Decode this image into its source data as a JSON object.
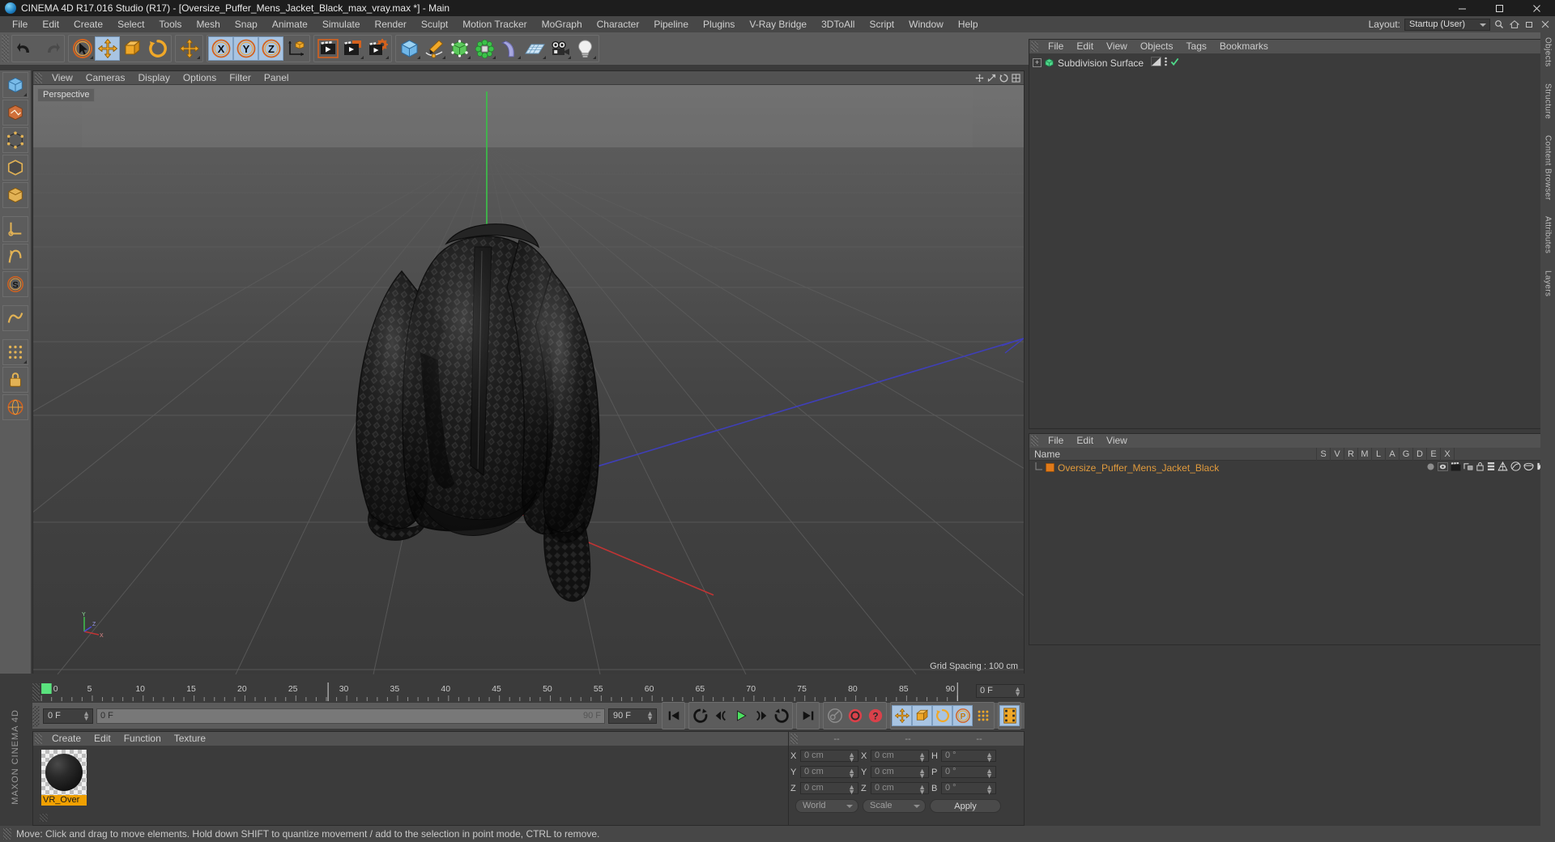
{
  "window": {
    "title": "CINEMA 4D R17.016 Studio (R17) - [Oversize_Puffer_Mens_Jacket_Black_max_vray.max *] - Main",
    "app_icon": "c4d-logo-icon",
    "minimize": "minimize-icon",
    "maximize": "maximize-icon",
    "close": "close-icon"
  },
  "menubar": {
    "items": [
      "File",
      "Edit",
      "Create",
      "Select",
      "Tools",
      "Mesh",
      "Snap",
      "Animate",
      "Simulate",
      "Render",
      "Sculpt",
      "Motion Tracker",
      "MoGraph",
      "Character",
      "Pipeline",
      "Plugins",
      "V-Ray Bridge",
      "3DToAll",
      "Script",
      "Window",
      "Help"
    ],
    "layout_label": "Layout:",
    "layout_value": "Startup (User)"
  },
  "toolbar": {
    "groups": [
      {
        "name": "history",
        "buttons": [
          {
            "name": "undo-button",
            "icon": "undo-icon",
            "active": false
          },
          {
            "name": "redo-button",
            "icon": "redo-icon",
            "active": false,
            "disabled": true
          }
        ]
      },
      {
        "name": "transform-tools",
        "buttons": [
          {
            "name": "live-selection-tool",
            "icon": "cursor-circle-icon",
            "active": false
          },
          {
            "name": "move-tool",
            "icon": "move-arrows-icon",
            "active": true
          },
          {
            "name": "scale-tool",
            "icon": "scale-box-icon",
            "active": false
          },
          {
            "name": "rotate-tool",
            "icon": "rotate-arc-icon",
            "active": false
          }
        ]
      },
      {
        "name": "general-move",
        "buttons": [
          {
            "name": "move-generic-tool",
            "icon": "move-arrows-icon",
            "active": false
          }
        ]
      },
      {
        "name": "axis-locks",
        "buttons": [
          {
            "name": "lock-x-axis",
            "icon": "x-axis-icon",
            "active": true
          },
          {
            "name": "lock-y-axis",
            "icon": "y-axis-icon",
            "active": true
          },
          {
            "name": "lock-z-axis",
            "icon": "z-axis-icon",
            "active": true
          },
          {
            "name": "world-object-coordinates",
            "icon": "world-axis-icon",
            "active": false
          }
        ]
      },
      {
        "name": "render-group",
        "buttons": [
          {
            "name": "render-view-button",
            "icon": "clapper-render-icon",
            "active": false
          },
          {
            "name": "render-to-picture-viewer",
            "icon": "clapper-picture-icon",
            "active": false
          },
          {
            "name": "render-settings",
            "icon": "clapper-gear-icon",
            "active": false
          }
        ]
      },
      {
        "name": "create-group",
        "buttons": [
          {
            "name": "add-cube-primitive",
            "icon": "cube-icon",
            "active": false
          },
          {
            "name": "add-spline",
            "icon": "pen-spline-icon",
            "active": false
          },
          {
            "name": "add-nurbs-generator",
            "icon": "green-cube-generator-icon",
            "active": false
          },
          {
            "name": "add-array-clone",
            "icon": "green-cluster-icon",
            "active": false
          },
          {
            "name": "add-deformer",
            "icon": "bend-deformer-icon",
            "active": false
          },
          {
            "name": "add-environment",
            "icon": "floor-grid-icon",
            "active": false
          },
          {
            "name": "add-camera",
            "icon": "camera-icon",
            "active": false
          },
          {
            "name": "add-light",
            "icon": "lightbulb-icon",
            "active": false
          }
        ]
      }
    ]
  },
  "left_palette": {
    "buttons": [
      {
        "name": "model-mode",
        "icon": "cube-blue-icon",
        "active": false
      },
      {
        "name": "texture-mode",
        "icon": "texture-icon",
        "active": false
      },
      {
        "name": "point-mode",
        "icon": "points-icon",
        "active": false
      },
      {
        "name": "edge-mode",
        "icon": "edges-icon",
        "active": false
      },
      {
        "name": "polygon-mode",
        "icon": "polygon-icon",
        "active": false
      },
      {
        "name": "enable-axis-modification",
        "icon": "axis-l-icon",
        "active": false
      },
      {
        "name": "enable-deformers",
        "icon": "deformer-toggle-icon",
        "active": false
      },
      {
        "name": "viewport-solo-single",
        "icon": "solo-s-icon",
        "active": false
      },
      {
        "name": "animation-tool",
        "icon": "animate-icon",
        "active": false
      },
      {
        "name": "snap-settings",
        "icon": "snap-grid-icon",
        "active": false
      },
      {
        "name": "lock-workplane",
        "icon": "lock-icon",
        "active": false
      },
      {
        "name": "workplane-mode",
        "icon": "workplane-icon",
        "active": false
      }
    ]
  },
  "viewport": {
    "menu": [
      "View",
      "Cameras",
      "Display",
      "Options",
      "Filter",
      "Panel"
    ],
    "view_label": "Perspective",
    "grid_spacing": "Grid Spacing : 100 cm",
    "axis_gizmo": {
      "y": "Y",
      "x": "X",
      "z": "Z"
    },
    "nav_icons": [
      "move-view-icon",
      "scale-view-icon",
      "rotate-view-icon",
      "maximize-view-icon"
    ]
  },
  "object_manager": {
    "menu": [
      "File",
      "Edit",
      "View",
      "Objects",
      "Tags",
      "Bookmarks"
    ],
    "rows": [
      {
        "name": "Subdivision Surface",
        "icon": "subdivision-surface-icon",
        "expandable": true,
        "tags": [
          "display-tag-icon",
          "dots-icon",
          "check-icon"
        ]
      }
    ]
  },
  "attribute_manager": {
    "menu": [
      "File",
      "Edit",
      "View"
    ],
    "columns": [
      "Name",
      "S",
      "V",
      "R",
      "M",
      "L",
      "A",
      "G",
      "D",
      "E",
      "X"
    ],
    "rows": [
      {
        "name": "Oversize_Puffer_Mens_Jacket_Black",
        "icon": "mesh-orange-icon"
      }
    ]
  },
  "timeline": {
    "ticks": [
      "0",
      "5",
      "10",
      "15",
      "20",
      "25",
      "30",
      "35",
      "40",
      "45",
      "50",
      "55",
      "60",
      "65",
      "70",
      "75",
      "80",
      "85",
      "90"
    ],
    "current_frame_marker": "0",
    "current_frame_field": "0 F",
    "start_frame": "0 F",
    "range_start": "0 F",
    "range_end": "90 F",
    "end_frame": "90 F"
  },
  "anim_controls": {
    "buttons": [
      {
        "name": "go-to-start-button",
        "icon": "skip-start-icon",
        "active": false
      },
      {
        "name": "go-to-previous-key-button",
        "icon": "prev-key-icon",
        "active": false
      },
      {
        "name": "step-back-button",
        "icon": "step-back-icon",
        "active": false
      },
      {
        "name": "play-button",
        "icon": "play-icon",
        "active": false
      },
      {
        "name": "step-forward-button",
        "icon": "step-forward-icon",
        "active": false
      },
      {
        "name": "go-to-next-key-button",
        "icon": "next-key-icon",
        "active": false
      },
      {
        "name": "go-to-end-button",
        "icon": "skip-end-icon",
        "active": false
      },
      {
        "name": "autokey-toggle-button",
        "icon": "key-icon",
        "active": false
      },
      {
        "name": "record-active-objects-button",
        "icon": "record-circle-icon",
        "active": false
      },
      {
        "name": "keyframe-selection-button",
        "icon": "question-circle-icon",
        "active": false
      },
      {
        "name": "position-key-button",
        "icon": "move-arrows-icon",
        "active": true
      },
      {
        "name": "scale-key-button",
        "icon": "scale-box-icon",
        "active": true
      },
      {
        "name": "rotation-key-button",
        "icon": "rotate-arc-icon",
        "active": true
      },
      {
        "name": "parameter-key-button",
        "icon": "param-p-icon",
        "active": true
      },
      {
        "name": "point-level-animation-button",
        "icon": "pla-dots-icon",
        "active": false
      },
      {
        "name": "timeline-toggle-button",
        "icon": "film-strip-icon",
        "active": true
      }
    ]
  },
  "material_manager": {
    "menu": [
      "Create",
      "Edit",
      "Function",
      "Texture"
    ],
    "materials": [
      {
        "name": "VR_Over",
        "full_name": "VR_Oversize_Puffer_Mens_Jacket_Black",
        "selected": true
      }
    ]
  },
  "coordinate_manager": {
    "header": [
      "--",
      "--",
      "--"
    ],
    "position": {
      "label_x": "X",
      "value_x": "0 cm",
      "label_y": "Y",
      "value_y": "0 cm",
      "label_z": "Z",
      "value_z": "0 cm"
    },
    "size": {
      "label_x": "X",
      "value_x": "0 cm",
      "label_y": "Y",
      "value_y": "0 cm",
      "label_z": "Z",
      "value_z": "0 cm"
    },
    "rotation": {
      "label_h": "H",
      "value_h": "0 °",
      "label_p": "P",
      "value_p": "0 °",
      "label_b": "B",
      "value_b": "0 °"
    },
    "coord_system": "World",
    "transform_mode": "Scale",
    "apply_label": "Apply"
  },
  "right_tabs": [
    "Objects",
    "Structure",
    "Content Browser",
    "Attributes",
    "Layers"
  ],
  "statusbar": {
    "text": "Move: Click and drag to move elements. Hold down SHIFT to quantize movement / add to the selection in point mode, CTRL to remove."
  },
  "brand": "MAXON CINEMA 4D",
  "colors": {
    "accent_blue": "#a8c4e2",
    "orange": "#f0a000",
    "background": "#3b3b3b",
    "toolbar": "#5c5c5c",
    "titlebar": "#1d1d1d",
    "axis_x": "#d13b3b",
    "axis_y": "#3cc84b",
    "axis_z": "#4040d0"
  }
}
